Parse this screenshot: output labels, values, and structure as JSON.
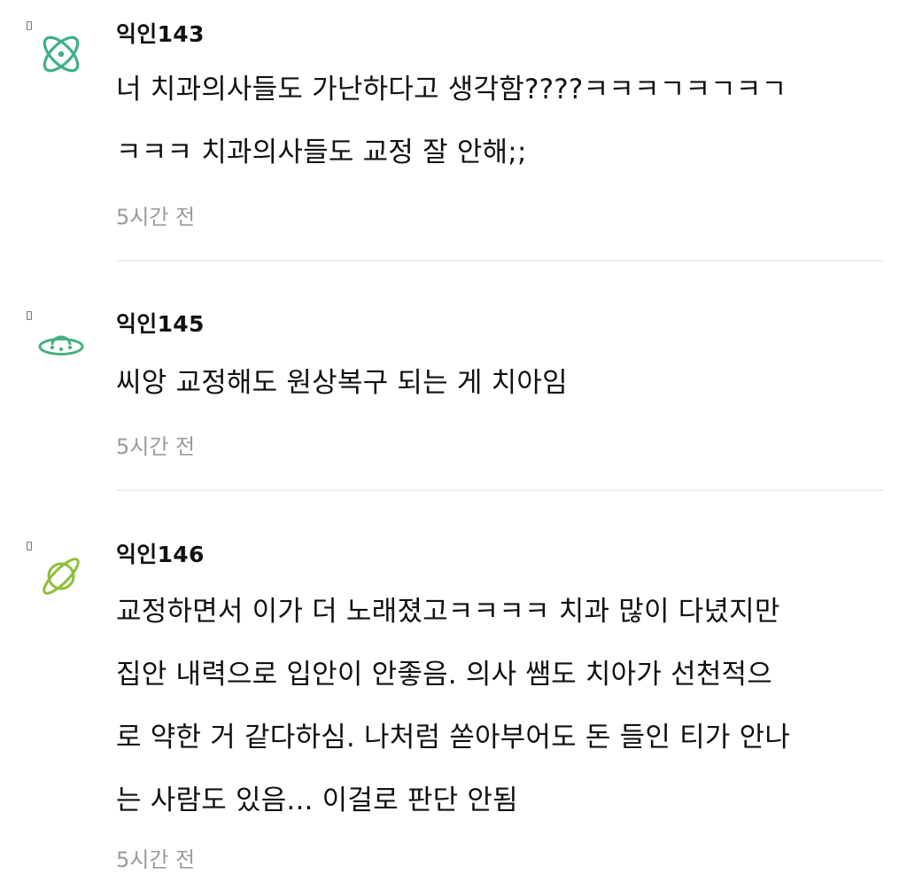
{
  "comments": [
    {
      "author": "익인143",
      "avatar_icon": "atom-icon",
      "avatar_color": "#3fb08a",
      "lines": [
        "너 치과의사들도 가난하다고 생각함????ㅋㅋㅋㄱㅋㄱㅋㄱ",
        "ㅋㅋㅋ 치과의사들도 교정 잘 안해;;"
      ],
      "time": "5시간 전"
    },
    {
      "author": "익인145",
      "avatar_icon": "ufo-icon",
      "avatar_color": "#48b07e",
      "lines": [
        "씨앙 교정해도 원상복구 되는 게 치아임"
      ],
      "time": "5시간 전"
    },
    {
      "author": "익인146",
      "avatar_icon": "planet-icon",
      "avatar_color": "#8fbe3a",
      "lines": [
        "교정하면서 이가 더 노래졌고ㅋㅋㅋㅋ 치과 많이 다녔지만",
        "집안 내력으로 입안이 안좋음. 의사 쌤도 치아가 선천적으",
        "로 약한 거 같다하심. 나처럼 쏟아부어도 돈 들인 티가 안나",
        "는 사람도 있음... 이걸로 판단 안됨"
      ],
      "time": "5시간 전"
    }
  ]
}
